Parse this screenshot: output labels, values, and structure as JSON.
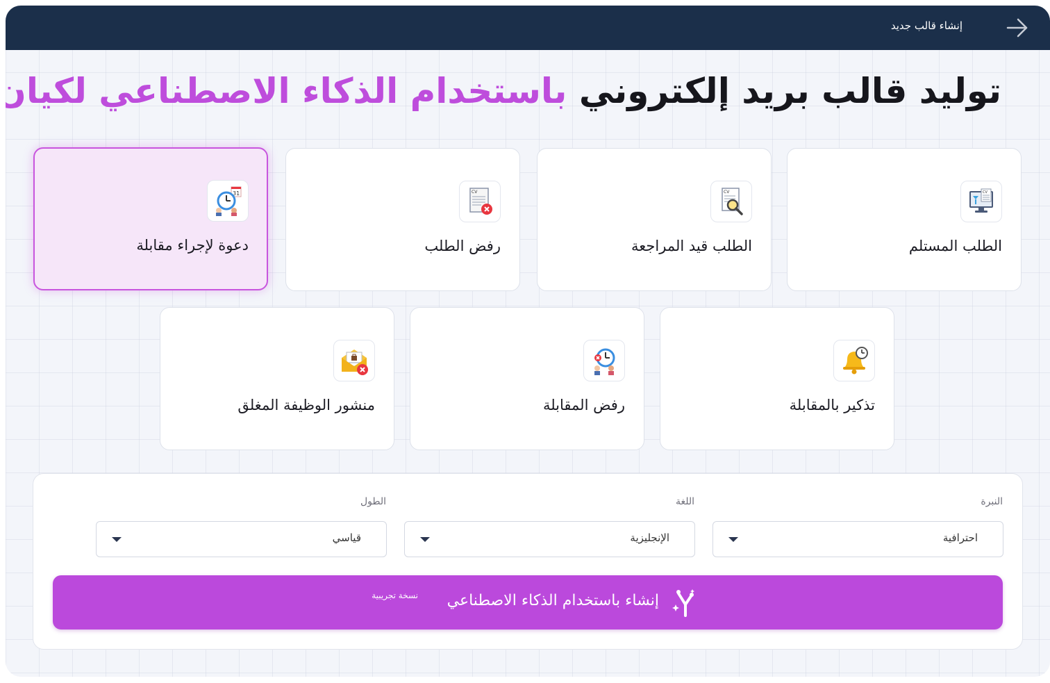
{
  "header": {
    "title": "إنشاء قالب جديد",
    "back_icon": "arrow-right-icon"
  },
  "heading": {
    "part1": "توليد قالب بريد إلكتروني",
    "part2": "باستخدام الذكاء الاصطناعي لكيان"
  },
  "templates": [
    {
      "label": "الطلب المستلم",
      "icon": "cv-received-icon",
      "selected": false
    },
    {
      "label": "الطلب قيد المراجعة",
      "icon": "cv-review-icon",
      "selected": false
    },
    {
      "label": "رفض الطلب",
      "icon": "cv-rejected-icon",
      "selected": false
    },
    {
      "label": "دعوة لإجراء مقابلة",
      "icon": "interview-invite-icon",
      "selected": true
    },
    {
      "label": "تذكير بالمقابلة",
      "icon": "bell-reminder-icon",
      "selected": false
    },
    {
      "label": "رفض المقابلة",
      "icon": "interview-rejected-icon",
      "selected": false
    },
    {
      "label": "منشور الوظيفة المغلق",
      "icon": "closed-post-icon",
      "selected": false
    }
  ],
  "form": {
    "tone": {
      "label": "النبرة",
      "value": "احترافية"
    },
    "language": {
      "label": "اللغة",
      "value": "الإنجليزية"
    },
    "length": {
      "label": "الطول",
      "value": "قياسي"
    }
  },
  "generate": {
    "label": "إنشاء باستخدام الذكاء الاصطناعي",
    "badge": "نسخة تجريبية",
    "icon": "ai-sparkle-icon"
  },
  "colors": {
    "header_bg": "#1b2f4a",
    "accent": "#bb49dc",
    "selected_card_bg": "#f6e6f9",
    "selected_card_border": "#c855de"
  }
}
